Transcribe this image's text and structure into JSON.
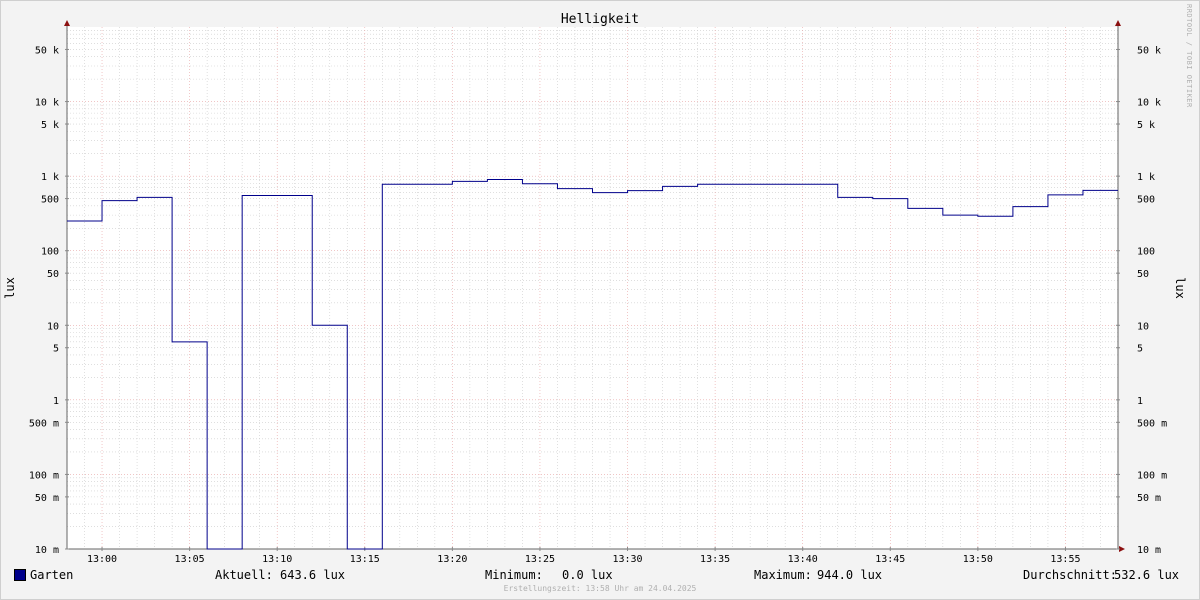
{
  "colors": {
    "series": "#00008b",
    "plot_bg": "#ffffff",
    "canvas_bg": "#f3f3f3",
    "grid_major": "#e8a3a3",
    "grid_minor": "#cccccc",
    "arrow": "#8b1010"
  },
  "watermark": "RRDTOOL / TOBI OETIKER",
  "legend": {
    "series_name": "Garten",
    "current_label": "Aktuell:",
    "current_value": "643.6 lux",
    "min_label": "Minimum:",
    "min_value": "0.0 lux",
    "max_label": "Maximum:",
    "max_value": "944.0 lux",
    "avg_label": "Durchschnitt:",
    "avg_value": "532.6 lux"
  },
  "footer": "Erstellungszeit: 13:58 Uhr am 24.04.2025",
  "chart_data": {
    "type": "line",
    "title": "Helligkeit",
    "ylabel": "lux",
    "yscale": "log",
    "grid": true,
    "xlim": [
      "12:58",
      "13:58"
    ],
    "ylim": [
      0.01,
      100000
    ],
    "x_ticks": [
      "13:00",
      "13:05",
      "13:10",
      "13:15",
      "13:20",
      "13:25",
      "13:30",
      "13:35",
      "13:40",
      "13:45",
      "13:50",
      "13:55"
    ],
    "y_ticks": [
      {
        "value": 0.01,
        "label": "10 m"
      },
      {
        "value": 0.05,
        "label": "50 m"
      },
      {
        "value": 0.1,
        "label": "100 m"
      },
      {
        "value": 0.5,
        "label": "500 m"
      },
      {
        "value": 1,
        "label": "1"
      },
      {
        "value": 5,
        "label": "5"
      },
      {
        "value": 10,
        "label": "10"
      },
      {
        "value": 50,
        "label": "50"
      },
      {
        "value": 100,
        "label": "100"
      },
      {
        "value": 500,
        "label": "500"
      },
      {
        "value": 1000,
        "label": "1 k"
      },
      {
        "value": 5000,
        "label": "5 k"
      },
      {
        "value": 10000,
        "label": "10 k"
      },
      {
        "value": 50000,
        "label": "50 k"
      }
    ],
    "series": [
      {
        "name": "Garten",
        "step": true,
        "points": [
          [
            "12:58",
            250
          ],
          [
            "13:00",
            470
          ],
          [
            "13:02",
            520
          ],
          [
            "13:04",
            6
          ],
          [
            "13:06",
            0
          ],
          [
            "13:08",
            550
          ],
          [
            "13:12",
            10
          ],
          [
            "13:14",
            0
          ],
          [
            "13:16",
            780
          ],
          [
            "13:20",
            850
          ],
          [
            "13:22",
            900
          ],
          [
            "13:24",
            790
          ],
          [
            "13:26",
            680
          ],
          [
            "13:28",
            600
          ],
          [
            "13:30",
            640
          ],
          [
            "13:32",
            730
          ],
          [
            "13:34",
            780
          ],
          [
            "13:42",
            520
          ],
          [
            "13:44",
            500
          ],
          [
            "13:46",
            370
          ],
          [
            "13:48",
            300
          ],
          [
            "13:50",
            290
          ],
          [
            "13:52",
            390
          ],
          [
            "13:54",
            560
          ],
          [
            "13:56",
            643.6
          ],
          [
            "13:58",
            643.6
          ]
        ]
      }
    ]
  }
}
